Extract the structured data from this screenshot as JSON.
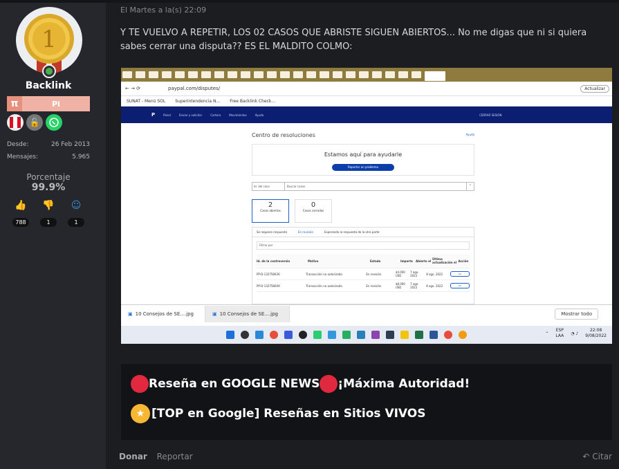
{
  "sidebar": {
    "username": "Backlink",
    "rank_symbol": "π",
    "rank_label": "Pi",
    "medal_number": "1",
    "joined_label": "Desde:",
    "joined_value": "26 Feb 2013",
    "messages_label": "Mensajes:",
    "messages_value": "5.965",
    "percent_label": "Porcentaje",
    "percent_value": "99.9%",
    "likes": "788",
    "dislikes": "1",
    "smiles": "1"
  },
  "post": {
    "date": "El Martes a la(s) 22:09",
    "text": "Y TE VUELVO A REPETIR, LOS 02 CASOS QUE ABRISTE SIGUEN ABIERTOS... No me digas que ni si quiera sabes cerrar una disputa?? ES EL MALDITO COLMO:"
  },
  "screenshot": {
    "url": "paypal.com/disputes/",
    "update_label": "Actualizar",
    "bookmarks": [
      "SUNAT - Menú SOL",
      "Superintendencia N...",
      "Free Backlink Check..."
    ],
    "paypal_nav": [
      "Panel",
      "Enviar y solicitar",
      "Cartera",
      "Movimientos",
      "Ayuda",
      "CERRAR SESIÓN"
    ],
    "center_title": "Centro de resoluciones",
    "help_link": "Ayuda",
    "help_heading": "Estamos aquí para ayudarle",
    "report_button": "Reportar un problema",
    "search_select": "Id. del caso",
    "search_placeholder": "Buscar casos",
    "open_count": "2",
    "open_label": "Casos abiertos",
    "closed_count": "0",
    "closed_label": "Casos cerrados",
    "tabs": [
      "Se requiere respuesta",
      "En revisión",
      "Esperando la respuesta de la otra parte"
    ],
    "filter": "Filtrar por",
    "columns": [
      "Id. de la controversia",
      "Motivo",
      "Estado",
      "Importe",
      "Abierto el",
      "Última actualización el",
      "Acción"
    ],
    "rows": [
      {
        "id": "PP-D-132758636",
        "reason": "Transacción no autorizada",
        "status": "En revisión",
        "amount": "$4.000 USD",
        "opened": "7 ago. 2022",
        "updated": "8 ago. 2022",
        "action": "Ver"
      },
      {
        "id": "PP-D-132758649",
        "reason": "Transacción no autorizada",
        "status": "En revisión",
        "amount": "$8.000 USD",
        "opened": "7 ago. 2022",
        "updated": "8 ago. 2022",
        "action": "Ver"
      }
    ],
    "downloads": [
      "10 Consejos de SE....jpg",
      "10 Consejos de SE....jpg"
    ],
    "show_all": "Mostrar todo",
    "lang": "ESP",
    "lang2": "LAA",
    "time": "22:08",
    "date": "9/08/2022"
  },
  "signature": {
    "line1a": "Reseña en GOOGLE NEWS",
    "line1b": "¡Máxima Autoridad!",
    "line2": "[TOP en Google] Reseñas en Sitios VIVOS"
  },
  "footer": {
    "donate": "Donar",
    "report": "Reportar",
    "quote": "Citar"
  },
  "colors": {
    "accent": "#e7907c",
    "paypal_blue": "#0b1e72",
    "signature_dot": "#e0293e"
  }
}
